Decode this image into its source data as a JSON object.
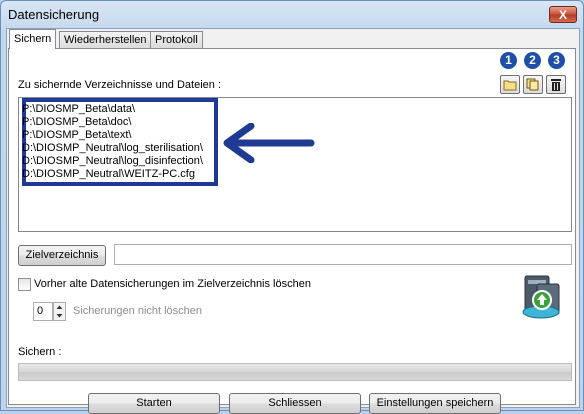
{
  "window": {
    "title": "Datensicherung",
    "close_glyph": "X"
  },
  "tabs": [
    {
      "label": "Sichern",
      "active": true
    },
    {
      "label": "Wiederherstellen",
      "active": false
    },
    {
      "label": "Protokoll",
      "active": false
    }
  ],
  "source_section": {
    "label": "Zu sichernde Verzeichnisse und Dateien :",
    "items": [
      "P:\\DIOSMP_Beta\\data\\",
      "P:\\DIOSMP_Beta\\doc\\",
      "P:\\DIOSMP_Beta\\text\\",
      "D:\\DIOSMP_Neutral\\log_sterilisation\\",
      "D:\\DIOSMP_Neutral\\log_disinfection\\",
      "D:\\DIOSMP_Neutral\\WEITZ-PC.cfg"
    ]
  },
  "toolbar": {
    "badges": [
      "1",
      "2",
      "3"
    ],
    "buttons": [
      {
        "icon": "folder-icon"
      },
      {
        "icon": "copy-files-icon"
      },
      {
        "icon": "trash-icon"
      }
    ]
  },
  "target": {
    "button_label": "Zielverzeichnis",
    "value": ""
  },
  "delete_old": {
    "label": "Vorher alte Datensicherungen im Zielverzeichnis löschen",
    "checked": false
  },
  "keep": {
    "value": "0",
    "label": "Sicherungen nicht löschen"
  },
  "progress": {
    "label": "Sichern :",
    "fraction": 0
  },
  "actions": {
    "start": "Starten",
    "close": "Schliessen",
    "save_settings": "Einstellungen speichern"
  },
  "colors": {
    "annotation": "#1f3a93",
    "badge": "#1f4fa6"
  }
}
